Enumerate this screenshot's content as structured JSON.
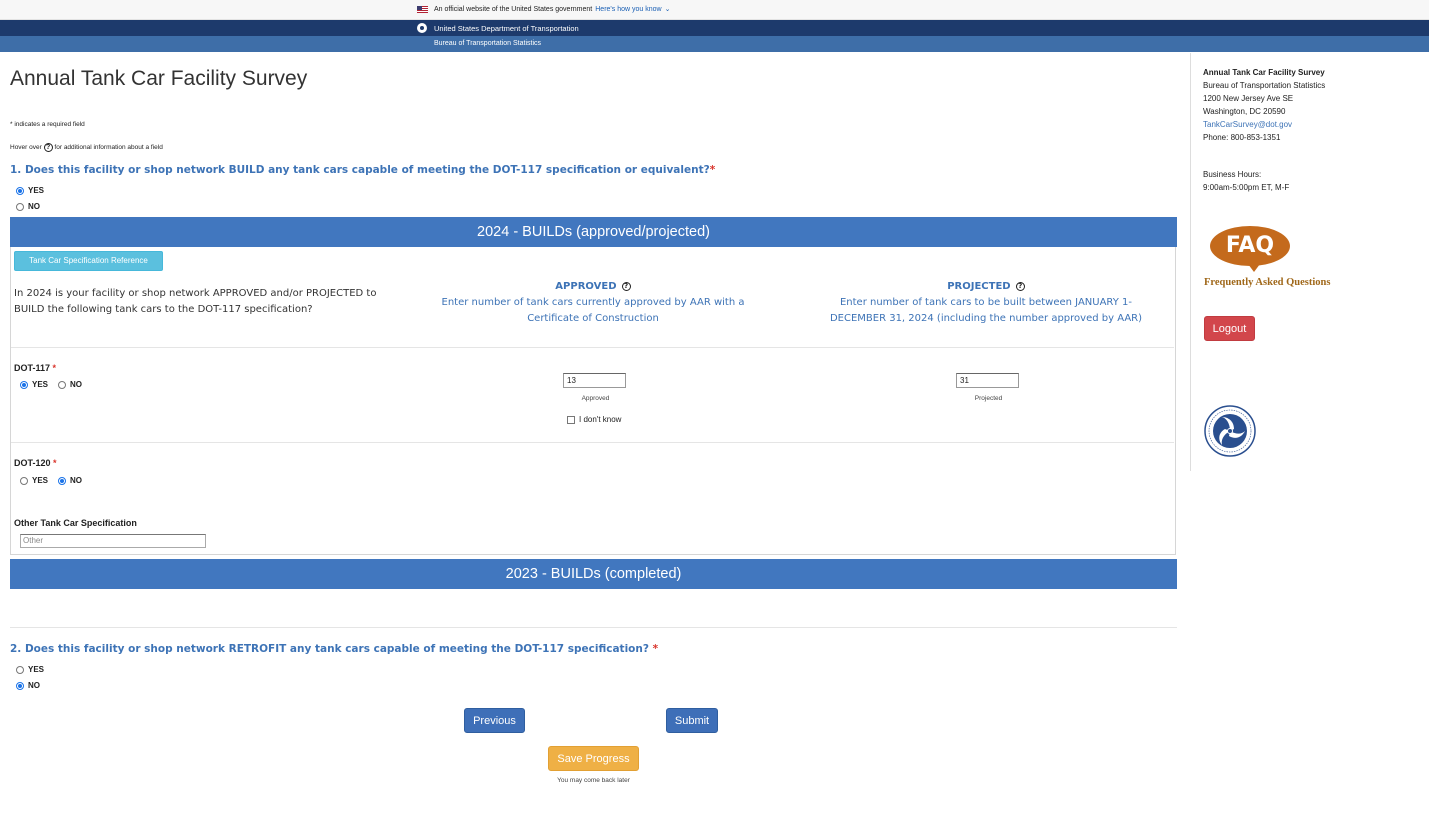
{
  "banner": {
    "official_text": "An official website of the United States government",
    "how_text": "Here's how you know",
    "department": "United States Department of Transportation",
    "bureau": "Bureau of Transportation Statistics"
  },
  "page": {
    "title": "Annual Tank Car Facility Survey",
    "required_note": "* indicates a required field",
    "hover_note_prefix": "Hover over",
    "hover_note_suffix": "for additional information about a field"
  },
  "q1": {
    "text": "1. Does this facility or shop network BUILD any tank cars capable of meeting the DOT-117 specification or equivalent?",
    "required_mark": "*",
    "options": {
      "yes": "YES",
      "no": "NO"
    },
    "selected": "YES"
  },
  "builds_2024": {
    "header": "2024 - BUILDs (approved/projected)",
    "spec_button": "Tank Car Specification Reference",
    "intro": "In 2024 is your facility or shop network APPROVED and/or PROJECTED to BUILD the following tank cars to the DOT-117 specification?",
    "approved": {
      "title": "APPROVED",
      "desc": "Enter number of tank cars currently approved by AAR with a Certificate of Construction"
    },
    "projected": {
      "title": "PROJECTED",
      "desc": "Enter number of tank cars to be built between JANUARY 1- DECEMBER 31, 2024 (including the number approved by AAR)"
    },
    "dot117": {
      "label": "DOT-117",
      "required_mark": "*",
      "yes": "YES",
      "no": "NO",
      "selected": "YES",
      "approved_value": "13",
      "approved_caption": "Approved",
      "projected_value": "31",
      "projected_caption": "Projected",
      "dont_know": "I don't know"
    },
    "dot120": {
      "label": "DOT-120",
      "required_mark": "*",
      "yes": "YES",
      "no": "NO",
      "selected": "NO"
    },
    "other": {
      "label": "Other Tank Car Specification",
      "placeholder": "Other"
    }
  },
  "builds_2023": {
    "header": "2023 - BUILDs (completed)"
  },
  "q2": {
    "text": "2. Does this facility or shop network RETROFIT any tank cars capable of meeting the DOT-117 specification?",
    "required_mark": "*",
    "options": {
      "yes": "YES",
      "no": "NO"
    },
    "selected": "NO"
  },
  "buttons": {
    "previous": "Previous",
    "submit": "Submit",
    "save": "Save Progress",
    "save_caption": "You may come back later",
    "logout": "Logout"
  },
  "sidebar": {
    "title": "Annual Tank Car Facility Survey",
    "org": "Bureau of Transportation Statistics",
    "address1": "1200 New Jersey Ave SE",
    "address2": "Washington, DC 20590",
    "email": "TankCarSurvey@dot.gov",
    "phone": "Phone: 800-853-1351",
    "hours_label": "Business Hours:",
    "hours": "9:00am-5:00pm ET, M-F",
    "faq_logo": "FAQ",
    "faq_text": "Frequently Asked Questions",
    "seal_icon": "dot-seal-icon"
  },
  "colors": {
    "accent_blue": "#4177bf",
    "question_blue": "#3d73b6",
    "required_red": "#d9342b",
    "save_gold": "#efb045",
    "logout_red": "#d2464b"
  }
}
